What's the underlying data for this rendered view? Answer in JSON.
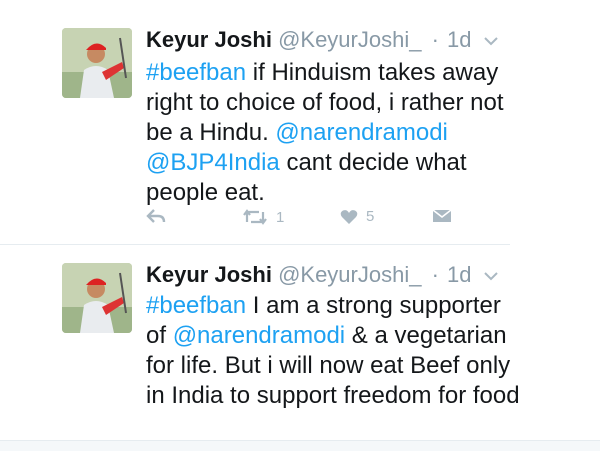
{
  "tweets": [
    {
      "author_name": "Keyur Joshi",
      "author_handle": "@KeyurJoshi_",
      "separator": "·",
      "time": "1d",
      "text_parts": [
        "#beefban",
        " if Hinduism takes away right to choice of food, i rather not be a Hindu. ",
        "@narendramodi",
        " ",
        "@BJP4India",
        " cant decide what people eat."
      ],
      "retweet_count": "1",
      "like_count": "5"
    },
    {
      "author_name": "Keyur Joshi",
      "author_handle": "@KeyurJoshi_",
      "separator": "·",
      "time": "1d",
      "text_parts": [
        "#beefban",
        " I am a strong supporter of ",
        "@narendramodi",
        " & a vegetarian for life. But i will now eat Beef only in India to support freedom for food"
      ]
    }
  ],
  "icons": {
    "reply": "reply-icon",
    "retweet": "retweet-icon",
    "like": "heart-icon",
    "message": "envelope-icon",
    "more": "chevron-down-icon"
  },
  "colors": {
    "link": "#1da1f2",
    "muted": "#8899a6",
    "action": "#aab8c2"
  }
}
